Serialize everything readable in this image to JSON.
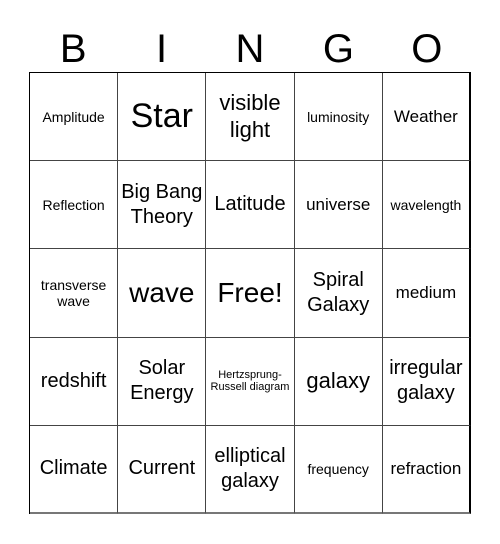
{
  "header": {
    "letters": [
      "B",
      "I",
      "N",
      "G",
      "O"
    ]
  },
  "board": {
    "cells": [
      {
        "text": "Amplitude",
        "size": "s-sm"
      },
      {
        "text": "Star",
        "size": "s-huge"
      },
      {
        "text": "visible light",
        "size": "s-xl"
      },
      {
        "text": "luminosity",
        "size": "s-sm"
      },
      {
        "text": "Weather",
        "size": "s-md"
      },
      {
        "text": "Reflection",
        "size": "s-sm"
      },
      {
        "text": "Big Bang Theory",
        "size": "s-lg"
      },
      {
        "text": "Latitude",
        "size": "s-lg"
      },
      {
        "text": "universe",
        "size": "s-md"
      },
      {
        "text": "wavelength",
        "size": "s-sm"
      },
      {
        "text": "transverse wave",
        "size": "s-sm"
      },
      {
        "text": "wave",
        "size": "s-xxl"
      },
      {
        "text": "Free!",
        "size": "s-xxl"
      },
      {
        "text": "Spiral Galaxy",
        "size": "s-lg"
      },
      {
        "text": "medium",
        "size": "s-md"
      },
      {
        "text": "redshift",
        "size": "s-lg"
      },
      {
        "text": "Solar Energy",
        "size": "s-lg"
      },
      {
        "text": "Hertzsprung-Russell diagram",
        "size": "s-xs"
      },
      {
        "text": "galaxy",
        "size": "s-xl"
      },
      {
        "text": "irregular galaxy",
        "size": "s-lg"
      },
      {
        "text": "Climate",
        "size": "s-lg"
      },
      {
        "text": "Current",
        "size": "s-lg"
      },
      {
        "text": "elliptical galaxy",
        "size": "s-lg"
      },
      {
        "text": "frequency",
        "size": "s-sm"
      },
      {
        "text": "refraction",
        "size": "s-md"
      }
    ],
    "free_space_index": 12
  }
}
